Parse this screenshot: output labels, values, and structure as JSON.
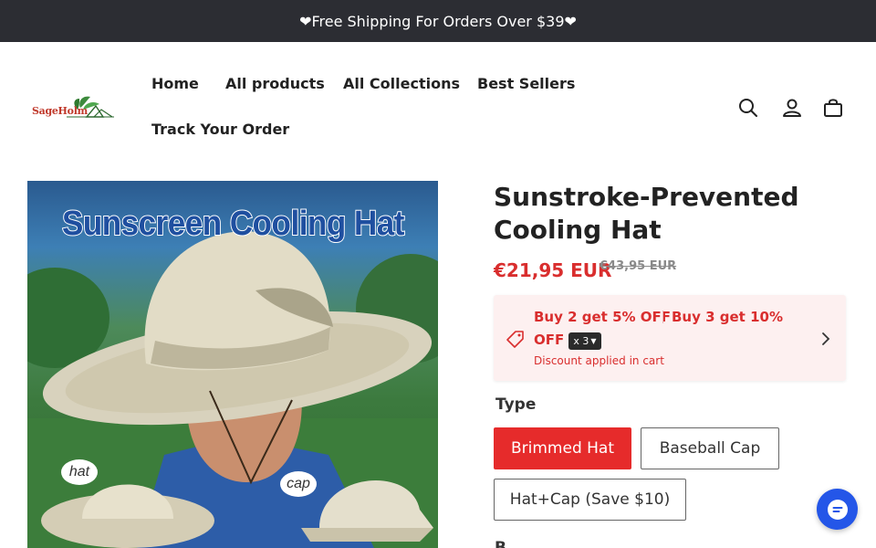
{
  "announcement": {
    "text": "❤Free Shipping For Orders Over $39❤"
  },
  "brand": {
    "logo_text": "SageHolm"
  },
  "nav": {
    "items": [
      {
        "label": "Home"
      },
      {
        "label": "All products"
      },
      {
        "label": "All Collections"
      },
      {
        "label": "Best Sellers"
      },
      {
        "label": "Track Your Order"
      }
    ]
  },
  "header_icons": [
    "search-icon",
    "account-icon",
    "cart-icon"
  ],
  "product": {
    "image": {
      "title": "Sunscreen Cooling Hat",
      "label_hat": "hat",
      "label_cap": "cap"
    },
    "title": "Sunstroke-Prevented Cooling Hat",
    "price": "€21,95 EUR",
    "compare_price": "€43,95 EUR",
    "promo": {
      "offer_1": "Buy 2 get 5% OFF",
      "offer_2": "Buy 3 get 10%",
      "offer_2_cont": "OFF",
      "qty_badge": "x 3",
      "note": "Discount applied in cart"
    },
    "type_label": "Type",
    "options": [
      {
        "label": "Brimmed Hat",
        "selected": true
      },
      {
        "label": "Baseball Cap",
        "selected": false
      },
      {
        "label": "Hat+Cap (Save $10)",
        "selected": false
      }
    ],
    "next_label": "B"
  },
  "colors": {
    "accent": "#e62b2b",
    "price": "#d92e2e",
    "announce_bg": "#2c2d33",
    "chat": "#2456e8"
  }
}
